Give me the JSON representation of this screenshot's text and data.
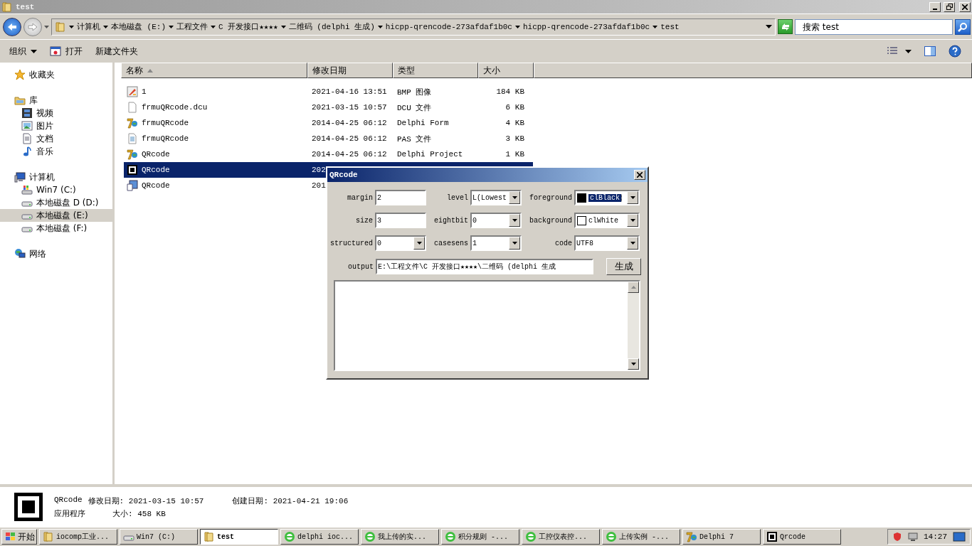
{
  "window": {
    "title": "test"
  },
  "address": {
    "crumbs": [
      "计算机",
      "本地磁盘 (E:)",
      "工程文件",
      "C 开发接口★★★★",
      "二维码 (delphi 生成)",
      "hicpp-qrencode-273afdaf1b0c",
      "hicpp-qrencode-273afdaf1b0c",
      "test"
    ]
  },
  "search": {
    "placeholder": "搜索 test"
  },
  "toolbar": [
    {
      "label": "组织",
      "kind": "menu"
    },
    {
      "label": "打开",
      "kind": "open"
    },
    {
      "label": "新建文件夹",
      "kind": "plain"
    }
  ],
  "sidebar": {
    "items": [
      {
        "label": "收藏夹",
        "kind": "star",
        "selected": false
      },
      {
        "label": "库",
        "kind": "library",
        "selected": false,
        "children": [
          {
            "label": "视频",
            "kind": "film",
            "selected": false
          },
          {
            "label": "图片",
            "kind": "image",
            "selected": false
          },
          {
            "label": "文档",
            "kind": "document",
            "selected": false
          },
          {
            "label": "音乐",
            "kind": "music",
            "selected": false
          }
        ]
      },
      {
        "label": "计算机",
        "kind": "computer",
        "selected": false,
        "children": [
          {
            "label": "Win7 (C:)",
            "kind": "system-drive",
            "selected": false
          },
          {
            "label": "本地磁盘 D (D:)",
            "kind": "drive",
            "selected": false
          },
          {
            "label": "本地磁盘 (E:)",
            "kind": "drive",
            "selected": true
          },
          {
            "label": "本地磁盘 (F:)",
            "kind": "drive",
            "selected": false
          }
        ]
      },
      {
        "label": "网络",
        "kind": "network",
        "selected": false
      }
    ]
  },
  "table": {
    "columns": [
      {
        "label": "名称",
        "sorted": true
      },
      {
        "label": "修改日期",
        "sorted": false
      },
      {
        "label": "类型",
        "sorted": false
      },
      {
        "label": "大小",
        "sorted": false
      }
    ],
    "rows": [
      {
        "kind": "bitmap",
        "name": "1",
        "date": "2021-04-16 13:51",
        "type": "BMP 图像",
        "size": "184 KB",
        "selected": false
      },
      {
        "kind": "file",
        "name": "frmuQRcode.dcu",
        "date": "2021-03-15 10:57",
        "type": "DCU 文件",
        "size": "6 KB",
        "selected": false
      },
      {
        "kind": "delphi",
        "name": "frmuQRcode",
        "date": "2014-04-25 06:12",
        "type": "Delphi Form",
        "size": "4 KB",
        "selected": false
      },
      {
        "kind": "source",
        "name": "frmuQRcode",
        "date": "2014-04-25 06:12",
        "type": "PAS 文件",
        "size": "3 KB",
        "selected": false
      },
      {
        "kind": "delphi",
        "name": "QRcode",
        "date": "2014-04-25 06:12",
        "type": "Delphi Project",
        "size": "1 KB",
        "selected": false
      },
      {
        "kind": "app",
        "name": "QRcode",
        "date": "202",
        "selected": true
      },
      {
        "kind": "resource",
        "name": "QRcode",
        "date": "201",
        "selected": false
      }
    ]
  },
  "details": {
    "name": "QRcode",
    "type": "应用程序",
    "modified": "修改日期: 2021-03-15 10:57",
    "size": "大小: 458 KB",
    "created": "创建日期: 2021-04-21 19:06"
  },
  "dialog": {
    "title": "QRcode",
    "fields": [
      {
        "label": "margin",
        "kind": "edit",
        "value": "2"
      },
      {
        "label": "level",
        "kind": "combo",
        "value": "L(Lowest"
      },
      {
        "label": "foreground",
        "kind": "color-combo",
        "value": "clBlack",
        "color": "#000000",
        "focused": true
      },
      {
        "label": "size",
        "kind": "edit",
        "value": "3"
      },
      {
        "label": "eightbit",
        "kind": "combo",
        "value": "0"
      },
      {
        "label": "background",
        "kind": "color-combo",
        "value": "clWhite",
        "color": "#ffffff",
        "focused": false
      },
      {
        "label": "structured",
        "kind": "combo",
        "value": "0"
      },
      {
        "label": "casesens",
        "kind": "combo",
        "value": "1"
      },
      {
        "label": "code",
        "kind": "combo",
        "value": "UTF8"
      }
    ],
    "output": {
      "label": "output",
      "value": "E:\\工程文件\\C 开发接口★★★★\\二维码 (delphi 生成"
    },
    "button": "生成"
  },
  "taskbar": {
    "start": "开始",
    "tasks": [
      {
        "label": "iocomp工业...",
        "kind": "folder",
        "selected": false
      },
      {
        "label": "Win7 (C:)",
        "kind": "drive",
        "selected": false
      },
      {
        "label": "test",
        "kind": "folder",
        "selected": true
      },
      {
        "label": "delphi ioc...",
        "kind": "browser",
        "selected": false
      },
      {
        "label": "我上传的实...",
        "kind": "browser",
        "selected": false
      },
      {
        "label": "积分规则 -...",
        "kind": "browser",
        "selected": false
      },
      {
        "label": "工控仪表控...",
        "kind": "browser",
        "selected": false
      },
      {
        "label": "上传实例 -...",
        "kind": "browser",
        "selected": false
      },
      {
        "label": "Delphi 7",
        "kind": "delphi",
        "selected": false
      },
      {
        "label": "Qrcode",
        "kind": "app",
        "selected": false
      }
    ],
    "clock": "14:27"
  }
}
